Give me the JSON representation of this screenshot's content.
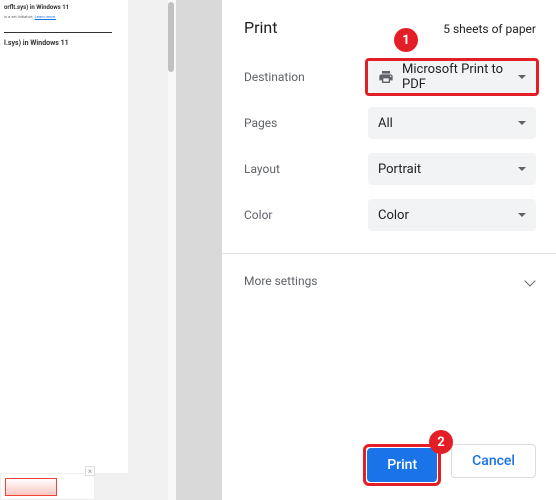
{
  "preview": {
    "line1": "orflt.sys) in Windows 11",
    "line3": "l.sys) in Windows 11",
    "link": "Learn more."
  },
  "panel": {
    "title": "Print",
    "sheets": "5 sheets of paper",
    "destination": {
      "label": "Destination",
      "value": "Microsoft Print to PDF"
    },
    "pages": {
      "label": "Pages",
      "value": "All"
    },
    "layout": {
      "label": "Layout",
      "value": "Portrait"
    },
    "color": {
      "label": "Color",
      "value": "Color"
    },
    "more": "More settings"
  },
  "footer": {
    "print": "Print",
    "cancel": "Cancel"
  },
  "annotations": {
    "badge1": "1",
    "badge2": "2"
  }
}
